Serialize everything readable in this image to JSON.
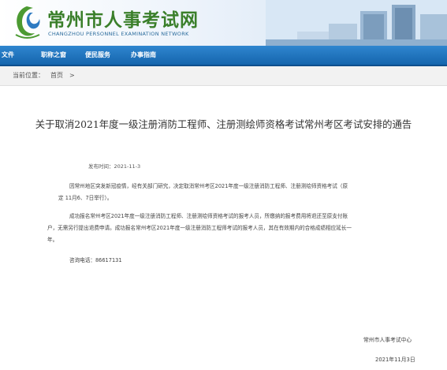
{
  "header": {
    "title": "常州市人事考试网",
    "subtitle": "CHANGZHOU PERSONNEL EXAMINATION NETWORK"
  },
  "nav": {
    "items": [
      {
        "label": "文件"
      },
      {
        "label": "职称之窗"
      },
      {
        "label": "便民服务"
      },
      {
        "label": "办事指南"
      }
    ]
  },
  "breadcrumb": {
    "prefix": "当前位置：",
    "home": "首页",
    "separator": ">"
  },
  "article": {
    "title": "关于取消2021年度一级注册消防工程师、注册测绘师资格考试常州考区考试安排的通告",
    "published": "发布时间：2021-11-3",
    "lines": [
      "因常州地区突发新冠疫情，经有关部门研究，决定取消常州考区2021年度一级注册消防工程师、注册测绘师资格考试（原",
      "定 11月6、7日举行）。",
      "成功报名常州考区2021年度一级注册消防工程师、注册测绘师资格考试的报考人员，所缴纳的报考费用将退还至原支付账",
      "户，无需另行提出退费申请。成功报名常州考区2021年度一级注册消防工程师考试的报考人员，其在有效期内的合格成绩相应延长一",
      "年。",
      "咨询电话：86617131"
    ],
    "signature": "常州市人事考试中心",
    "date": "2021年11月3日"
  }
}
